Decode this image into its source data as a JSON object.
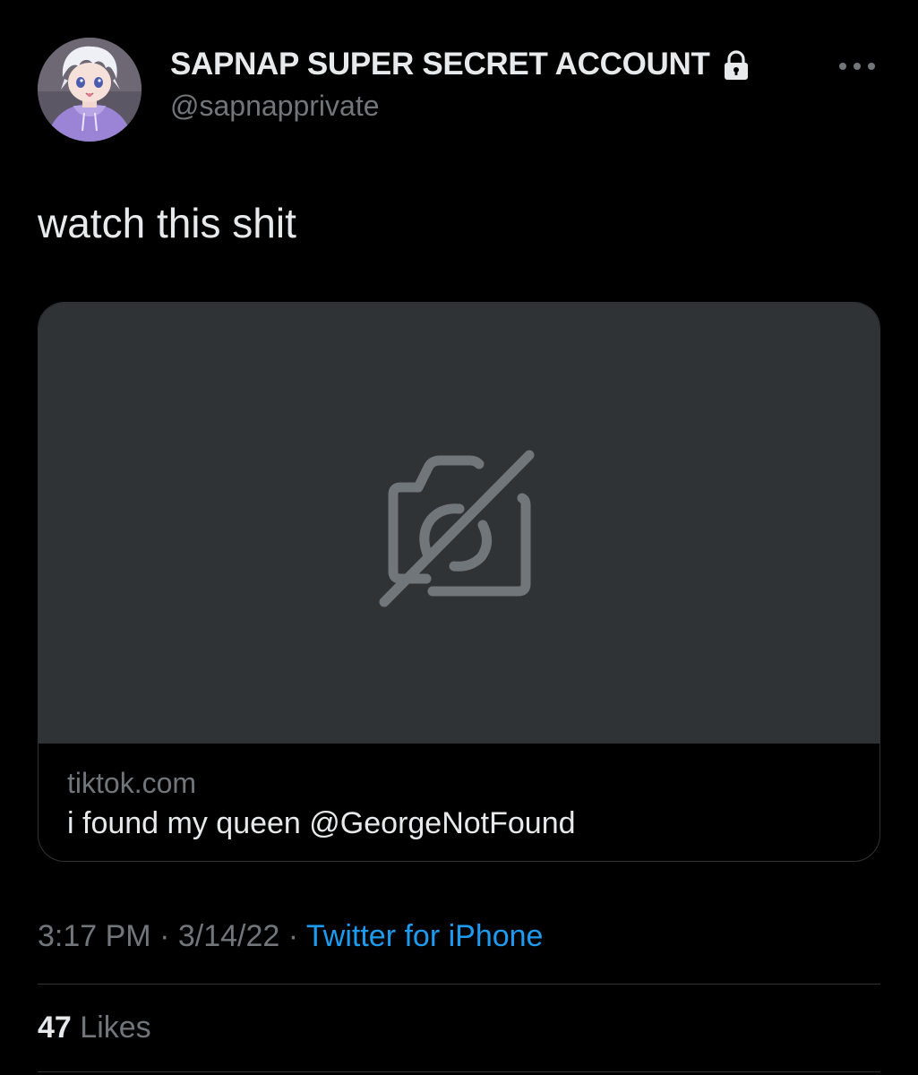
{
  "user": {
    "display_name": "SAPNAP SUPER SECRET ACCOUNT",
    "handle": "@sapnapprivate",
    "avatar_icon": "anime-character-avatar",
    "protected_icon": "lock-icon"
  },
  "tweet": {
    "text": "watch this shit"
  },
  "card": {
    "media_icon": "broken-image-icon",
    "domain": "tiktok.com",
    "title": "i found my queen @GeorgeNotFound"
  },
  "meta": {
    "time": "3:17 PM",
    "separator": " · ",
    "date": "3/14/22",
    "source": "Twitter for iPhone"
  },
  "stats": {
    "likes_count": "47",
    "likes_label": "Likes"
  },
  "colors": {
    "background": "#000000",
    "text_primary": "#e7e9ea",
    "text_secondary": "#71767b",
    "link": "#1d9bf0",
    "card_media_bg": "#2f3336",
    "border": "#2f3336"
  }
}
